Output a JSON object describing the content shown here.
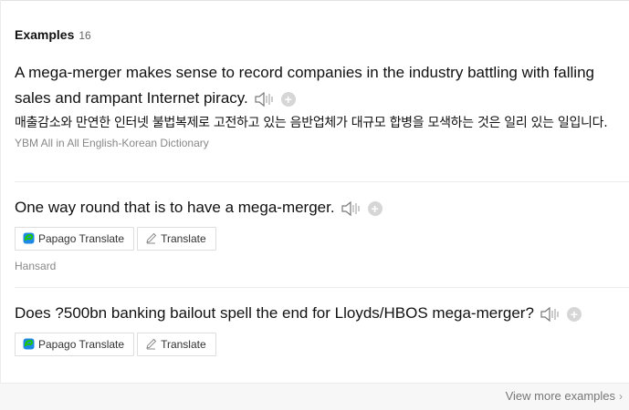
{
  "header": {
    "title": "Examples",
    "count": "16"
  },
  "examples": [
    {
      "sentence": "A mega-merger makes sense to record companies in the industry battling with falling sales and rampant Internet piracy.",
      "translation": "매출감소와 만연한 인터넷 불법복제로 고전하고 있는 음반업체가 대규모 합병을 모색하는 것은 일리 있는 일입니다.",
      "source": "YBM All in All English-Korean Dictionary"
    },
    {
      "sentence": "One way round that is to have a mega-merger.",
      "papago_label": "Papago Translate",
      "translate_label": "Translate",
      "source": "Hansard"
    },
    {
      "sentence": "Does ?500bn banking bailout spell the end for Lloyds/HBOS mega-merger?",
      "papago_label": "Papago Translate",
      "translate_label": "Translate"
    }
  ],
  "footer": {
    "more_label": "View more examples"
  },
  "icons": {
    "speaker": "speaker-icon",
    "add": "plus-circle-icon",
    "papago": "papago-logo-icon",
    "pencil": "pencil-icon",
    "chevron": "chevron-right-icon"
  },
  "colors": {
    "text": "#111111",
    "muted": "#888888",
    "border": "#dedede",
    "papago_green": "#1ec800",
    "papago_blue": "#1e88e5"
  }
}
